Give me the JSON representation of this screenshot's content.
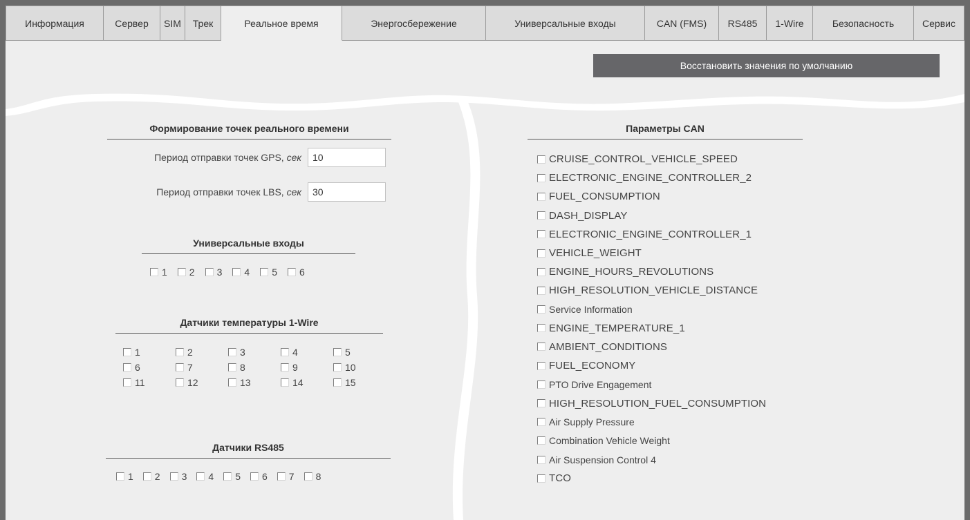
{
  "tabs": [
    {
      "label": "Информация",
      "active": false
    },
    {
      "label": "Сервер",
      "active": false
    },
    {
      "label": "SIM",
      "active": false
    },
    {
      "label": "Трек",
      "active": false
    },
    {
      "label": "Реальное время",
      "active": true
    },
    {
      "label": "Энергосбережение",
      "active": false
    },
    {
      "label": "Универсальные входы",
      "active": false
    },
    {
      "label": "CAN (FMS)",
      "active": false
    },
    {
      "label": "RS485",
      "active": false
    },
    {
      "label": "1-Wire",
      "active": false
    },
    {
      "label": "Безопасность",
      "active": false
    },
    {
      "label": "Сервис",
      "active": false
    }
  ],
  "restore_button": "Восстановить значения по умолчанию",
  "realtime": {
    "title": "Формирование точек реального времени",
    "gps_label": "Период отправки точек GPS,",
    "gps_unit": "сек",
    "gps_value": "10",
    "lbs_label": "Период отправки точек LBS,",
    "lbs_unit": "сек",
    "lbs_value": "30"
  },
  "universal_inputs": {
    "title": "Универсальные входы",
    "items": [
      "1",
      "2",
      "3",
      "4",
      "5",
      "6"
    ]
  },
  "onewire": {
    "title": "Датчики температуры 1-Wire",
    "items": [
      "1",
      "2",
      "3",
      "4",
      "5",
      "6",
      "7",
      "8",
      "9",
      "10",
      "11",
      "12",
      "13",
      "14",
      "15"
    ]
  },
  "rs485": {
    "title": "Датчики RS485",
    "items": [
      "1",
      "2",
      "3",
      "4",
      "5",
      "6",
      "7",
      "8"
    ]
  },
  "can": {
    "title": "Параметры CAN",
    "items": [
      "CRUISE_CONTROL_VEHICLE_SPEED",
      "ELECTRONIC_ENGINE_CONTROLLER_2",
      "FUEL_CONSUMPTION",
      "DASH_DISPLAY",
      "ELECTRONIC_ENGINE_CONTROLLER_1",
      "VEHICLE_WEIGHT",
      "ENGINE_HOURS_REVOLUTIONS",
      "HIGH_RESOLUTION_VEHICLE_DISTANCE",
      "Service Information",
      "ENGINE_TEMPERATURE_1",
      "AMBIENT_CONDITIONS",
      "FUEL_ECONOMY",
      "PTO Drive Engagement",
      "HIGH_RESOLUTION_FUEL_CONSUMPTION",
      "Air Supply Pressure",
      "Combination Vehicle Weight",
      "Air Suspension Control 4",
      "TCO"
    ]
  },
  "colors": {
    "background": "#eeeeee",
    "frame": "#6b6b6b",
    "button": "#666669",
    "tab_inactive": "#dcdcdc"
  }
}
